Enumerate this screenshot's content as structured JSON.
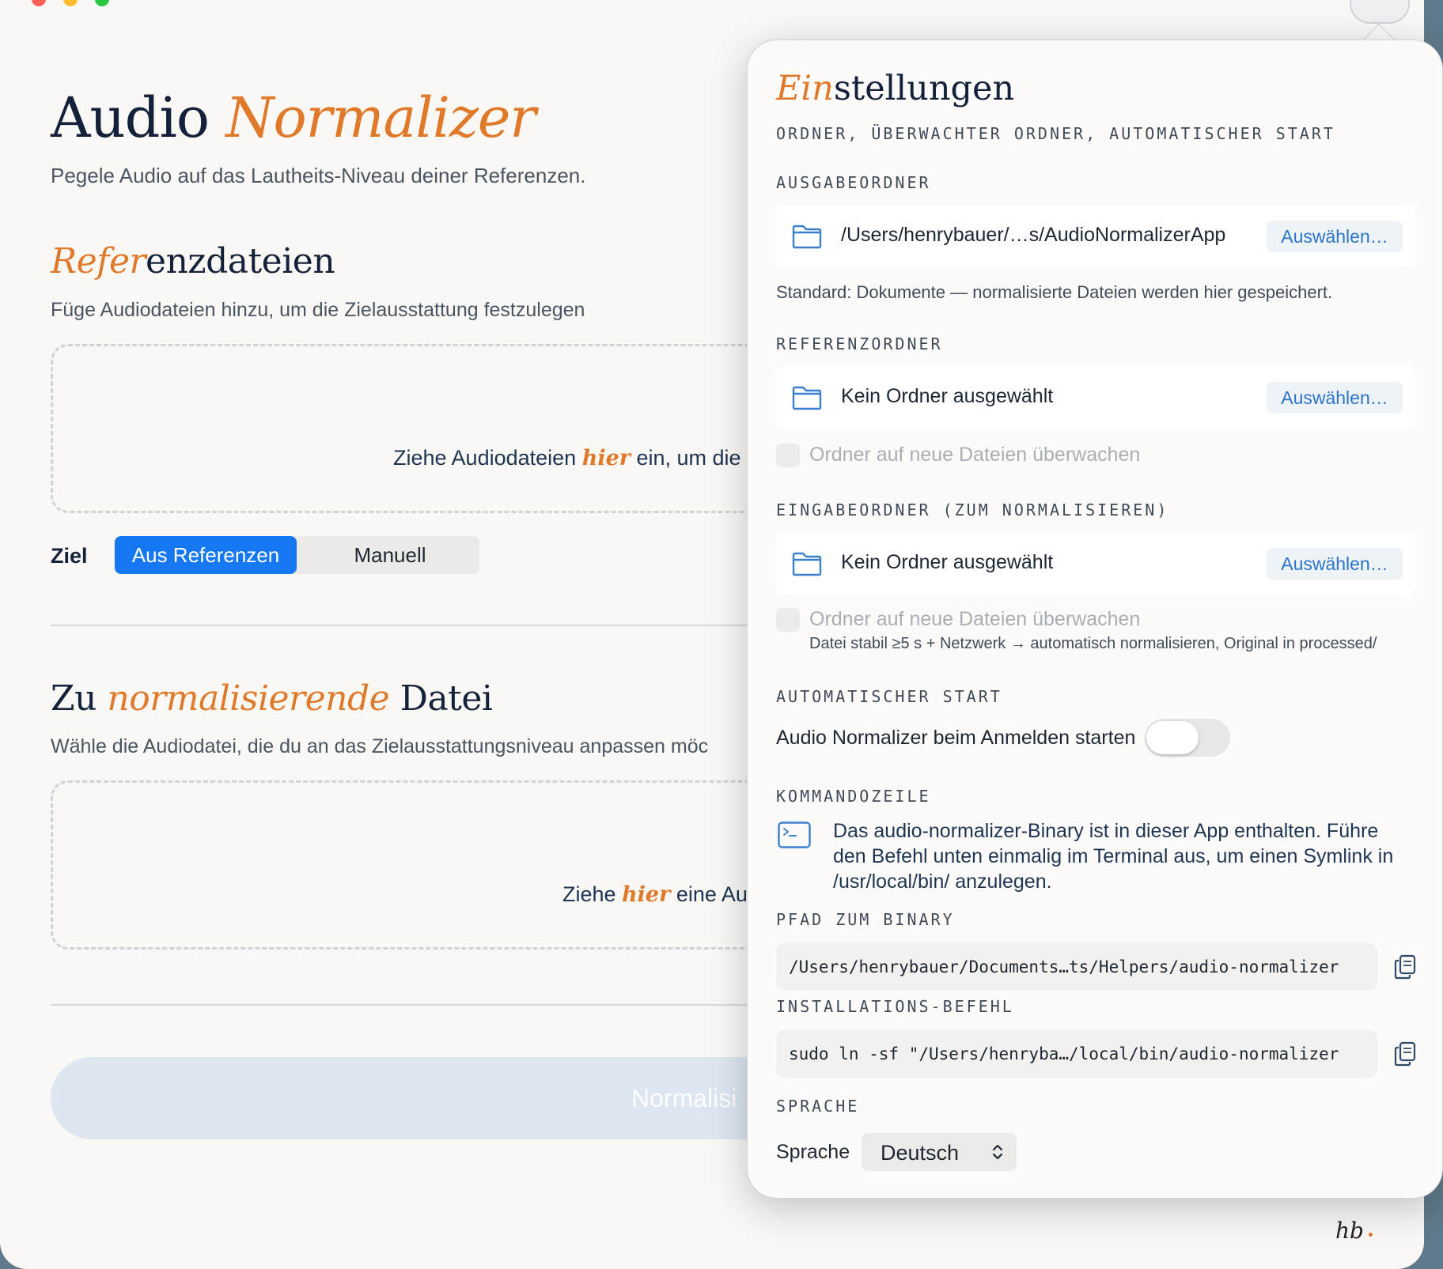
{
  "app": {
    "title_plain": "Audio ",
    "title_accent": "Normalizer",
    "subtitle": "Pegele Audio auf das Lautheits-Niveau deiner Referenzen."
  },
  "references": {
    "title_accent": "Refer",
    "title_plain": "enzdateien",
    "subtitle": "Füge Audiodateien hinzu, um die Zielausstattung festzulegen",
    "drop_before": "Ziehe Audiodateien ",
    "drop_accent": "hier",
    "drop_after": " ein, um die"
  },
  "target": {
    "label": "Ziel",
    "options": [
      "Aus Referenzen",
      "Manuell"
    ],
    "selected": "Aus Referenzen"
  },
  "input_file": {
    "title_plain_1": "Zu ",
    "title_accent": "normalisierende",
    "title_plain_2": " Datei",
    "subtitle": "Wähle die Audiodatei, die du an das Zielausstattungsniveau anpassen möc",
    "drop_before": "Ziehe ",
    "drop_accent": "hier",
    "drop_after": " eine Au"
  },
  "normalize_button": "Normalisi",
  "footer_mark": "hb",
  "settings": {
    "title_accent": "Ein",
    "title_plain": "stellungen",
    "subtitle": "ORDNER, ÜBERWACHTER ORDNER, AUTOMATISCHER START",
    "output": {
      "label": "AUSGABEORDNER",
      "path": "/Users/henrybauer/…s/AudioNormalizerApp",
      "choose": "Auswählen…",
      "hint": "Standard: Dokumente — normalisierte Dateien werden hier gespeichert."
    },
    "reference_folder": {
      "label": "REFERENZORDNER",
      "path": "Kein Ordner ausgewählt",
      "choose": "Auswählen…",
      "watch": "Ordner auf neue Dateien überwachen"
    },
    "input_folder": {
      "label": "EINGABEORDNER (ZUM NORMALISIEREN)",
      "path": "Kein Ordner ausgewählt",
      "choose": "Auswählen…",
      "watch": "Ordner auf neue Dateien überwachen",
      "watch_hint": "Datei stabil ≥5 s + Netzwerk → automatisch normalisieren, Original in processed/"
    },
    "autostart": {
      "label": "AUTOMATISCHER START",
      "toggle_label": "Audio Normalizer beim Anmelden starten",
      "enabled": false
    },
    "cli": {
      "label": "KOMMANDOZEILE",
      "text": "Das audio-normalizer-Binary ist in dieser App enthalten. Führe den Befehl unten einmalig im Terminal aus, um einen Symlink in /usr/local/bin/ anzulegen.",
      "binary_label": "PFAD ZUM BINARY",
      "binary_path": "/Users/henrybauer/Documents…ts/Helpers/audio-normalizer",
      "install_label": "INSTALLATIONS-BEFEHL",
      "install_cmd": "sudo ln -sf \"/Users/henryba…/local/bin/audio-normalizer"
    },
    "language": {
      "label": "SPRACHE",
      "field_label": "Sprache",
      "value": "Deutsch"
    }
  }
}
